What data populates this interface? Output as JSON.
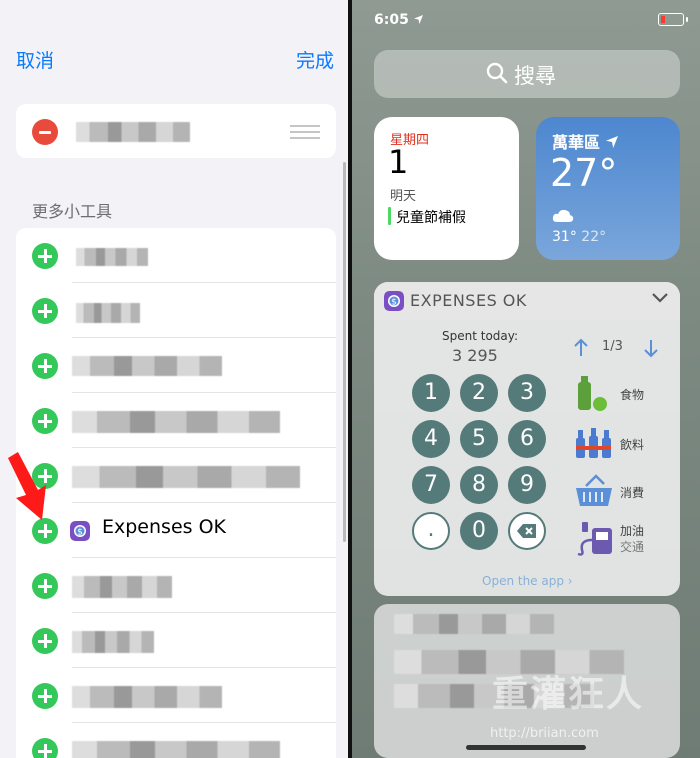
{
  "left": {
    "nav": {
      "cancel": "取消",
      "done": "完成"
    },
    "section_title": "更多小工具",
    "highlighted_item": {
      "label": "Expenses OK"
    }
  },
  "right": {
    "status": {
      "time": "6:05"
    },
    "search": {
      "placeholder": "搜尋"
    },
    "calendar": {
      "weekday": "星期四",
      "date": "1",
      "tomorrow": "明天",
      "event": "兒童節補假"
    },
    "weather": {
      "city": "萬華區",
      "temp": "27°",
      "high": "31°",
      "low": "22°"
    },
    "expenses": {
      "title": "EXPENSES OK",
      "spent_label": "Spent today:",
      "spent_value": "3 295",
      "pager": "1/3",
      "keys": [
        "1",
        "2",
        "3",
        "4",
        "5",
        "6",
        "7",
        "8",
        "9",
        ".",
        "0"
      ],
      "categories": [
        {
          "label": "食物",
          "sub": "",
          "icon": "food-icon"
        },
        {
          "label": "飲料",
          "sub": "",
          "icon": "drinks-icon"
        },
        {
          "label": "消費",
          "sub": "",
          "icon": "basket-icon"
        },
        {
          "label": "加油",
          "sub": "交通",
          "icon": "fuel-icon"
        }
      ],
      "open_app": "Open the app"
    },
    "watermark": {
      "main": "重灌狂人",
      "url": "http://briian.com"
    }
  },
  "colors": {
    "accent": "#0a7aff",
    "add": "#34c759",
    "remove": "#e84a3c",
    "keypad": "#547a7a"
  }
}
